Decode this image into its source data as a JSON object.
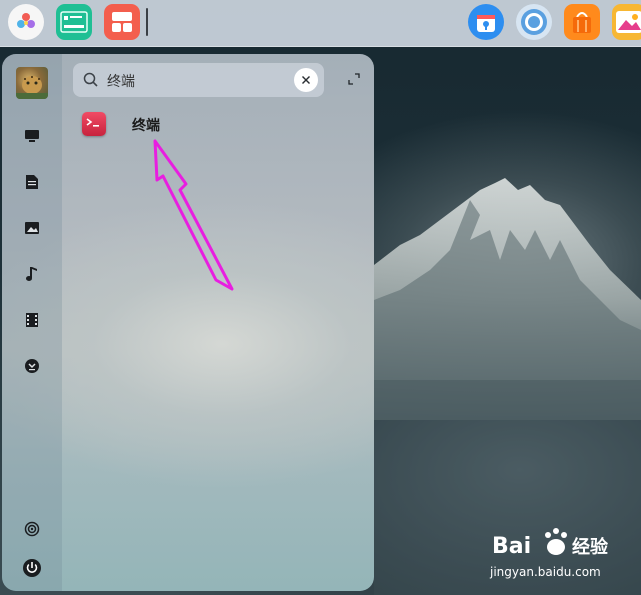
{
  "dock": {
    "apps": [
      {
        "name": "launcher",
        "icon": "flower-launcher-icon"
      },
      {
        "name": "terminal-app",
        "icon": "terminal-green-icon"
      },
      {
        "name": "app-store-grid",
        "icon": "grid-app-icon"
      },
      {
        "name": "store",
        "icon": "store-app-icon"
      },
      {
        "name": "chrome",
        "icon": "chrome-icon"
      },
      {
        "name": "shop",
        "icon": "shopping-bag-icon"
      },
      {
        "name": "photos",
        "icon": "photos-icon"
      }
    ]
  },
  "launcher": {
    "search": {
      "value": "终端",
      "placeholder": ""
    },
    "sidebar": [
      "computer-icon",
      "document-icon",
      "picture-icon",
      "music-icon",
      "video-icon",
      "download-icon",
      "settings-icon",
      "power-icon"
    ],
    "results": [
      {
        "label": "终端",
        "icon": "terminal-icon"
      }
    ]
  },
  "colors": {
    "arrow": "#e81ee0",
    "terminal_icon": "#e23651"
  },
  "watermark": {
    "brand": "Bai",
    "brand2": "经验",
    "url": "jingyan.baidu.com"
  }
}
